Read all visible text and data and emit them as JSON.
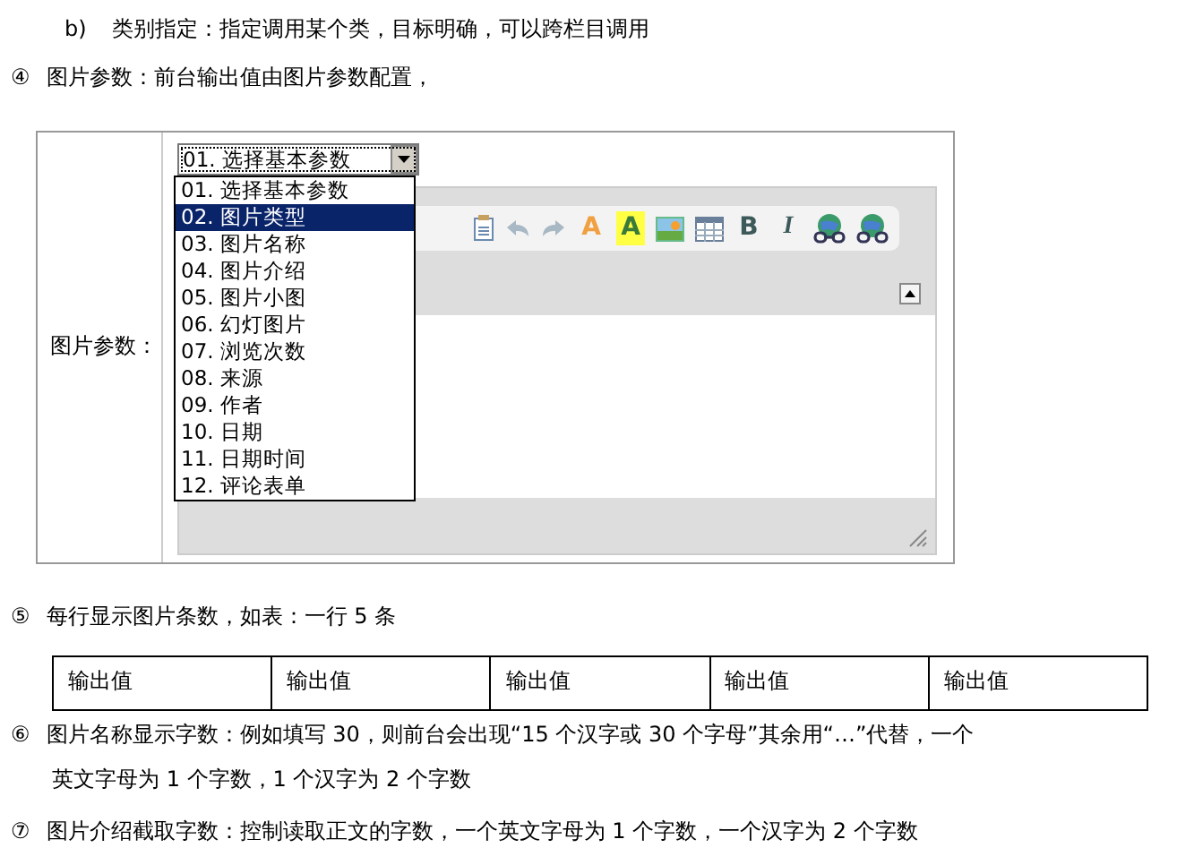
{
  "intro": [
    {
      "marker": "b)",
      "text": "类别指定：指定调用某个类，目标明确，可以跨栏目调用",
      "indented": true
    },
    {
      "marker": "④",
      "text": "图片参数：前台输出值由图片参数配置，",
      "indented": false
    }
  ],
  "figure": {
    "field_label": "图片参数：",
    "select": {
      "value": "01. 选择基本参数",
      "expanded": true
    },
    "options": [
      {
        "label": "01. 选择基本参数",
        "selected": false
      },
      {
        "label": "02. 图片类型",
        "selected": true
      },
      {
        "label": "03. 图片名称",
        "selected": false
      },
      {
        "label": "04. 图片介绍",
        "selected": false
      },
      {
        "label": "05. 图片小图",
        "selected": false
      },
      {
        "label": "06. 幻灯图片",
        "selected": false
      },
      {
        "label": "07. 浏览次数",
        "selected": false
      },
      {
        "label": "08. 来源",
        "selected": false
      },
      {
        "label": "09. 作者",
        "selected": false
      },
      {
        "label": "10. 日期",
        "selected": false
      },
      {
        "label": "11. 日期时间",
        "selected": false
      },
      {
        "label": "12. 评论表单",
        "selected": false
      }
    ],
    "toolbar": [
      {
        "kind": "paste"
      },
      {
        "kind": "undo"
      },
      {
        "kind": "redo"
      },
      {
        "kind": "font-color",
        "label": "A"
      },
      {
        "kind": "highlight",
        "label": "A"
      },
      {
        "kind": "image"
      },
      {
        "kind": "table"
      },
      {
        "kind": "bold",
        "label": "B"
      },
      {
        "kind": "italic",
        "label": "I"
      },
      {
        "kind": "link"
      },
      {
        "kind": "unlink"
      }
    ]
  },
  "item5": {
    "marker": "⑤",
    "text": "每行显示图片条数，如表：一行 5 条"
  },
  "table": {
    "cells": [
      "输出值",
      "输出值",
      "输出值",
      "输出值",
      "输出值"
    ]
  },
  "item6": {
    "marker": "⑥",
    "lines": [
      "图片名称显示字数：例如填写 30，则前台会出现“15 个汉字或 30 个字母”其余用“…”代替，一个",
      "英文字母为 1 个字数，1 个汉字为 2 个字数"
    ]
  },
  "item7": {
    "marker": "⑦",
    "text": "图片介绍截取字数：控制读取正文的字数，一个英文字母为 1 个字数，一个汉字为 2 个字数"
  }
}
